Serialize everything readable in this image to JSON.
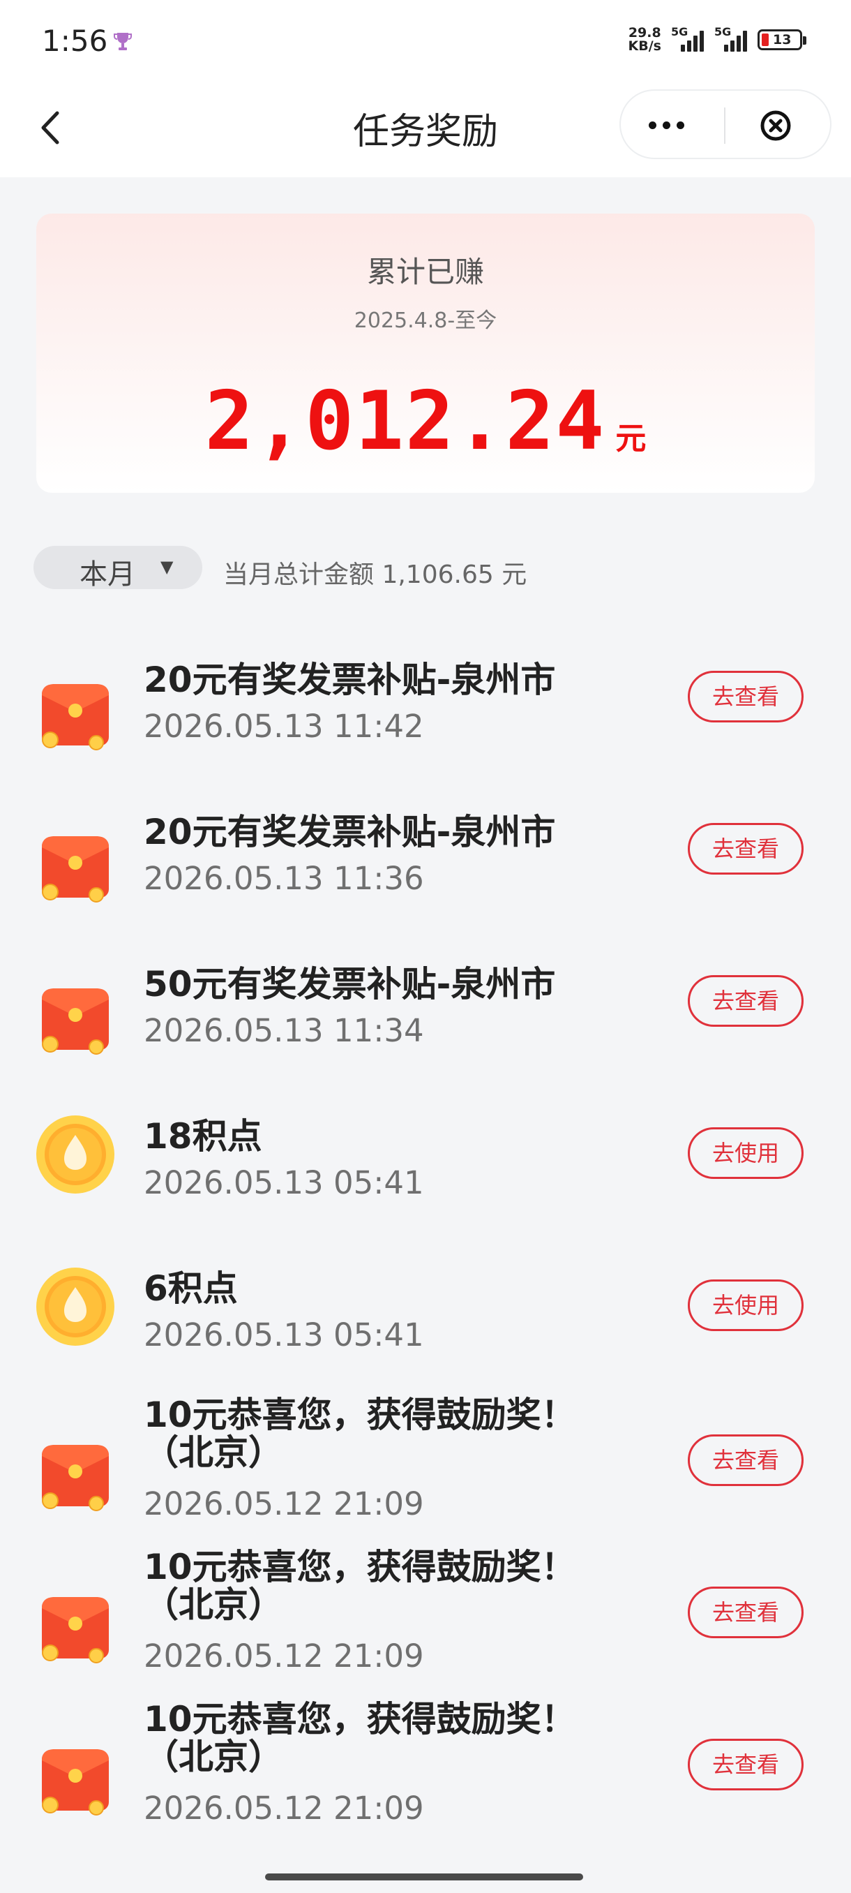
{
  "status_bar": {
    "time": "1:56",
    "net_speed_value": "29.8",
    "net_speed_unit": "KB/s",
    "signal_1": "5G",
    "signal_2": "5G",
    "battery": "13",
    "battery_color": "#e32020"
  },
  "nav": {
    "title": "任务奖励",
    "back_icon": "chevron-left-icon",
    "more_icon": "more-dots-icon",
    "close_icon": "circle-close-icon"
  },
  "summary": {
    "label": "累计已赚",
    "date_range": "2025.4.8-至今",
    "amount": "2,012.24",
    "unit": "元",
    "accent_color": "#ee1111"
  },
  "filter": {
    "month": "本月",
    "caret": "▼",
    "month_total": "当月总计金额 1,106.65 元"
  },
  "rewards": [
    {
      "title": "20元有奖发票补贴-泉州市",
      "date": "2026.05.13 11:42",
      "action": "去查看",
      "icon": "red-envelope-icon"
    },
    {
      "title": "20元有奖发票补贴-泉州市",
      "date": "2026.05.13 11:36",
      "action": "去查看",
      "icon": "red-envelope-icon"
    },
    {
      "title": "50元有奖发票补贴-泉州市",
      "date": "2026.05.13 11:34",
      "action": "去查看",
      "icon": "red-envelope-icon"
    },
    {
      "title": "18积点",
      "date": "2026.05.13 05:41",
      "action": "去使用",
      "icon": "points-coin-icon"
    },
    {
      "title": "6积点",
      "date": "2026.05.13 05:41",
      "action": "去使用",
      "icon": "points-coin-icon"
    },
    {
      "title": "10元恭喜您，获得鼓励奖！（北京）",
      "date": "2026.05.12 21:09",
      "action": "去查看",
      "icon": "red-envelope-icon"
    },
    {
      "title": "10元恭喜您，获得鼓励奖！（北京）",
      "date": "2026.05.12 21:09",
      "action": "去查看",
      "icon": "red-envelope-icon"
    },
    {
      "title": "10元恭喜您，获得鼓励奖！（北京）",
      "date": "2026.05.12 21:09",
      "action": "去查看",
      "icon": "red-envelope-icon"
    }
  ],
  "action_color": "#e0313b"
}
